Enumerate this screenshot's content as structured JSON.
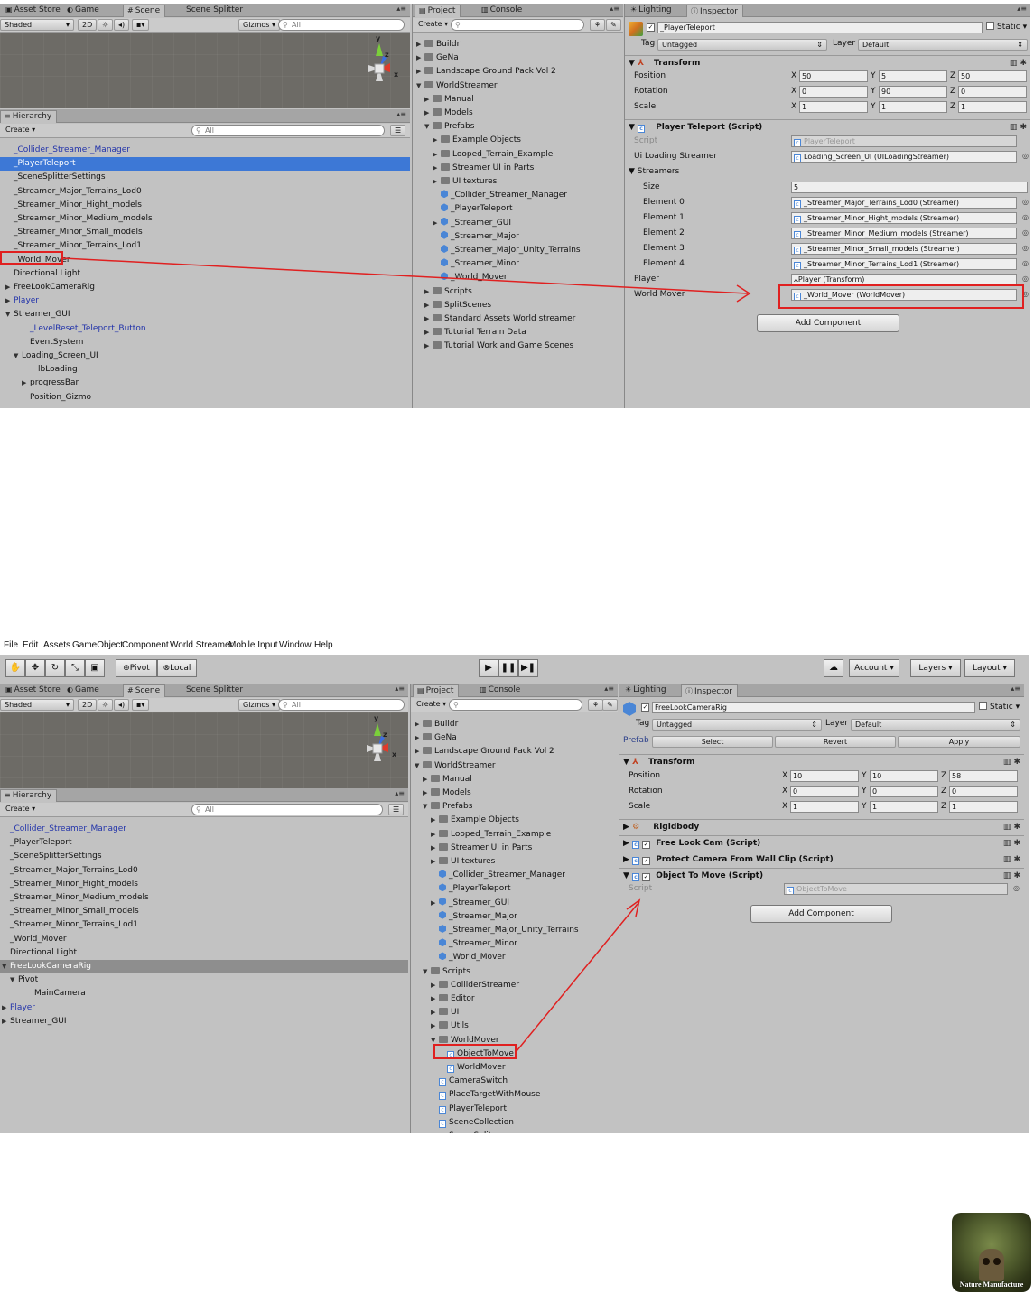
{
  "shot1": {
    "scene_tabs": [
      "Asset Store",
      "Game",
      "Scene",
      "Scene Splitter"
    ],
    "scene_toolbar": {
      "shading": "Shaded",
      "mode_2d": "2D",
      "gizmos": "Gizmos",
      "search": "All"
    },
    "gizmo_axes": {
      "y": "y",
      "z": "z",
      "x": "x"
    },
    "hierarchy": {
      "tab": "Hierarchy",
      "create": "Create",
      "search": "All",
      "items": [
        {
          "label": "_Collider_Streamer_Manager",
          "style": "blue"
        },
        {
          "label": "_PlayerTeleport",
          "style": "sel"
        },
        {
          "label": "_SceneSplitterSettings",
          "style": ""
        },
        {
          "label": "_Streamer_Major_Terrains_Lod0",
          "style": ""
        },
        {
          "label": "_Streamer_Minor_Hight_models",
          "style": ""
        },
        {
          "label": "_Streamer_Minor_Medium_models",
          "style": ""
        },
        {
          "label": "_Streamer_Minor_Small_models",
          "style": ""
        },
        {
          "label": "_Streamer_Minor_Terrains_Lod1",
          "style": ""
        },
        {
          "label": "_World_Mover",
          "style": ""
        },
        {
          "label": "Directional Light",
          "style": ""
        },
        {
          "label": "FreeLookCameraRig",
          "style": "",
          "tri": "▶"
        },
        {
          "label": "Player",
          "style": "blue",
          "tri": "▶"
        },
        {
          "label": "Streamer_GUI",
          "style": "",
          "tri": "▼"
        },
        {
          "label": "_LevelReset_Teleport_Button",
          "style": "blue",
          "indent": 2
        },
        {
          "label": "EventSystem",
          "style": "",
          "indent": 2
        },
        {
          "label": "Loading_Screen_UI",
          "style": "",
          "tri": "▼",
          "indent": 1
        },
        {
          "label": "lbLoading",
          "style": "",
          "indent": 3
        },
        {
          "label": "progressBar",
          "style": "",
          "tri": "▶",
          "indent": 2
        },
        {
          "label": "Position_Gizmo",
          "style": "",
          "indent": 2
        }
      ]
    },
    "project": {
      "tabs": [
        "Project",
        "Console"
      ],
      "create": "Create",
      "items": [
        {
          "label": "Buildr",
          "kind": "folder",
          "indent": 0,
          "tri": "▶"
        },
        {
          "label": "GeNa",
          "kind": "folder",
          "indent": 0,
          "tri": "▶"
        },
        {
          "label": "Landscape Ground Pack  Vol 2",
          "kind": "folder",
          "indent": 0,
          "tri": "▶"
        },
        {
          "label": "WorldStreamer",
          "kind": "folder",
          "indent": 0,
          "tri": "▼"
        },
        {
          "label": "Manual",
          "kind": "folder",
          "indent": 1,
          "tri": "▶"
        },
        {
          "label": "Models",
          "kind": "folder",
          "indent": 1,
          "tri": "▶"
        },
        {
          "label": "Prefabs",
          "kind": "folder",
          "indent": 1,
          "tri": "▼"
        },
        {
          "label": "Example Objects",
          "kind": "folder",
          "indent": 2,
          "tri": "▶"
        },
        {
          "label": "Looped_Terrain_Example",
          "kind": "folder",
          "indent": 2,
          "tri": "▶"
        },
        {
          "label": "Streamer UI in Parts",
          "kind": "folder",
          "indent": 2,
          "tri": "▶"
        },
        {
          "label": "UI textures",
          "kind": "folder",
          "indent": 2,
          "tri": "▶"
        },
        {
          "label": "_Collider_Streamer_Manager",
          "kind": "prefab",
          "indent": 2
        },
        {
          "label": "_PlayerTeleport",
          "kind": "prefab",
          "indent": 2
        },
        {
          "label": "_Streamer_GUI",
          "kind": "prefab",
          "indent": 2,
          "tri": "▶"
        },
        {
          "label": "_Streamer_Major",
          "kind": "prefab",
          "indent": 2
        },
        {
          "label": "_Streamer_Major_Unity_Terrains",
          "kind": "prefab",
          "indent": 2
        },
        {
          "label": "_Streamer_Minor",
          "kind": "prefab",
          "indent": 2
        },
        {
          "label": "_World_Mover",
          "kind": "prefab",
          "indent": 2
        },
        {
          "label": "Scripts",
          "kind": "folder",
          "indent": 1,
          "tri": "▶"
        },
        {
          "label": "SplitScenes",
          "kind": "folder",
          "indent": 1,
          "tri": "▶"
        },
        {
          "label": "Standard Assets World streamer",
          "kind": "folder",
          "indent": 1,
          "tri": "▶"
        },
        {
          "label": "Tutorial Terrain Data",
          "kind": "folder",
          "indent": 1,
          "tri": "▶"
        },
        {
          "label": "Tutorial Work and Game Scenes",
          "kind": "folder",
          "indent": 1,
          "tri": "▶"
        }
      ]
    },
    "inspector": {
      "tabs": [
        "Lighting",
        "Inspector"
      ],
      "object_name": "_PlayerTeleport",
      "static_label": "Static",
      "tag_label": "Tag",
      "tag_value": "Untagged",
      "layer_label": "Layer",
      "layer_value": "Default",
      "transform_title": "Transform",
      "position_label": "Position",
      "position": [
        "50",
        "5",
        "50"
      ],
      "rotation_label": "Rotation",
      "rotation": [
        "0",
        "90",
        "0"
      ],
      "scale_label": "Scale",
      "scale": [
        "1",
        "1",
        "1"
      ],
      "axis": [
        "X",
        "Y",
        "Z"
      ],
      "script_title": "Player Teleport (Script)",
      "script_label": "Script",
      "script_value": "PlayerTeleport",
      "ui_label": "Ui Loading Streamer",
      "ui_value": "Loading_Screen_UI (UILoadingStreamer)",
      "streamers_label": "Streamers",
      "size_label": "Size",
      "size_value": "5",
      "elements": [
        {
          "label": "Element 0",
          "value": "_Streamer_Major_Terrains_Lod0 (Streamer)"
        },
        {
          "label": "Element 1",
          "value": "_Streamer_Minor_Hight_models (Streamer)"
        },
        {
          "label": "Element 2",
          "value": "_Streamer_Minor_Medium_models (Streamer)"
        },
        {
          "label": "Element 3",
          "value": "_Streamer_Minor_Small_models (Streamer)"
        },
        {
          "label": "Element 4",
          "value": "_Streamer_Minor_Terrains_Lod1 (Streamer)"
        }
      ],
      "player_label": "Player",
      "player_value": "Player (Transform)",
      "world_mover_label": "World Mover",
      "world_mover_value": "_World_Mover (WorldMover)",
      "add_component": "Add Component"
    }
  },
  "shot2": {
    "menu": [
      "File",
      "Edit",
      "Assets",
      "GameObject",
      "Component",
      "World Streamer",
      "Mobile Input",
      "Window",
      "Help"
    ],
    "toolbar": {
      "pivot": "Pivot",
      "local": "Local",
      "account": "Account",
      "layers": "Layers",
      "layout": "Layout"
    },
    "scene_tabs": [
      "Asset Store",
      "Game",
      "Scene",
      "Scene Splitter"
    ],
    "scene_toolbar": {
      "shading": "Shaded",
      "mode_2d": "2D",
      "gizmos": "Gizmos",
      "search": "All"
    },
    "gizmo_axes": {
      "y": "y",
      "z": "z",
      "x": "x"
    },
    "hierarchy": {
      "tab": "Hierarchy",
      "create": "Create",
      "search": "All",
      "items": [
        {
          "label": "_Collider_Streamer_Manager",
          "style": "blue"
        },
        {
          "label": "_PlayerTeleport",
          "style": ""
        },
        {
          "label": "_SceneSplitterSettings",
          "style": ""
        },
        {
          "label": "_Streamer_Major_Terrains_Lod0",
          "style": ""
        },
        {
          "label": "_Streamer_Minor_Hight_models",
          "style": ""
        },
        {
          "label": "_Streamer_Minor_Medium_models",
          "style": ""
        },
        {
          "label": "_Streamer_Minor_Small_models",
          "style": ""
        },
        {
          "label": "_Streamer_Minor_Terrains_Lod1",
          "style": ""
        },
        {
          "label": "_World_Mover",
          "style": ""
        },
        {
          "label": "Directional Light",
          "style": ""
        },
        {
          "label": "FreeLookCameraRig",
          "style": "hl",
          "tri": "▼"
        },
        {
          "label": "Pivot",
          "style": "",
          "tri": "▼",
          "indent": 1
        },
        {
          "label": "MainCamera",
          "style": "",
          "indent": 3
        },
        {
          "label": "Player",
          "style": "blue",
          "tri": "▶"
        },
        {
          "label": "Streamer_GUI",
          "style": "",
          "tri": "▶"
        }
      ]
    },
    "project": {
      "tabs": [
        "Project",
        "Console"
      ],
      "create": "Create",
      "items": [
        {
          "label": "Buildr",
          "kind": "folder",
          "indent": 0,
          "tri": "▶"
        },
        {
          "label": "GeNa",
          "kind": "folder",
          "indent": 0,
          "tri": "▶"
        },
        {
          "label": "Landscape Ground Pack  Vol 2",
          "kind": "folder",
          "indent": 0,
          "tri": "▶"
        },
        {
          "label": "WorldStreamer",
          "kind": "folder",
          "indent": 0,
          "tri": "▼"
        },
        {
          "label": "Manual",
          "kind": "folder",
          "indent": 1,
          "tri": "▶"
        },
        {
          "label": "Models",
          "kind": "folder",
          "indent": 1,
          "tri": "▶"
        },
        {
          "label": "Prefabs",
          "kind": "folder",
          "indent": 1,
          "tri": "▼"
        },
        {
          "label": "Example Objects",
          "kind": "folder",
          "indent": 2,
          "tri": "▶"
        },
        {
          "label": "Looped_Terrain_Example",
          "kind": "folder",
          "indent": 2,
          "tri": "▶"
        },
        {
          "label": "Streamer UI in Parts",
          "kind": "folder",
          "indent": 2,
          "tri": "▶"
        },
        {
          "label": "UI textures",
          "kind": "folder",
          "indent": 2,
          "tri": "▶"
        },
        {
          "label": "_Collider_Streamer_Manager",
          "kind": "prefab",
          "indent": 2
        },
        {
          "label": "_PlayerTeleport",
          "kind": "prefab",
          "indent": 2
        },
        {
          "label": "_Streamer_GUI",
          "kind": "prefab",
          "indent": 2,
          "tri": "▶"
        },
        {
          "label": "_Streamer_Major",
          "kind": "prefab",
          "indent": 2
        },
        {
          "label": "_Streamer_Major_Unity_Terrains",
          "kind": "prefab",
          "indent": 2
        },
        {
          "label": "_Streamer_Minor",
          "kind": "prefab",
          "indent": 2
        },
        {
          "label": "_World_Mover",
          "kind": "prefab",
          "indent": 2
        },
        {
          "label": "Scripts",
          "kind": "folder",
          "indent": 1,
          "tri": "▼"
        },
        {
          "label": "ColliderStreamer",
          "kind": "folder",
          "indent": 2,
          "tri": "▶"
        },
        {
          "label": "Editor",
          "kind": "folder",
          "indent": 2,
          "tri": "▶"
        },
        {
          "label": "UI",
          "kind": "folder",
          "indent": 2,
          "tri": "▶"
        },
        {
          "label": "Utils",
          "kind": "folder",
          "indent": 2,
          "tri": "▶"
        },
        {
          "label": "WorldMover",
          "kind": "folder",
          "indent": 2,
          "tri": "▼"
        },
        {
          "label": "ObjectToMove",
          "kind": "script",
          "indent": 3
        },
        {
          "label": "WorldMover",
          "kind": "script",
          "indent": 3
        },
        {
          "label": "CameraSwitch",
          "kind": "script",
          "indent": 2
        },
        {
          "label": "PlaceTargetWithMouse",
          "kind": "script",
          "indent": 2
        },
        {
          "label": "PlayerTeleport",
          "kind": "script",
          "indent": 2
        },
        {
          "label": "SceneCollection",
          "kind": "script",
          "indent": 2
        },
        {
          "label": "SceneSplit",
          "kind": "script",
          "indent": 2
        }
      ]
    },
    "inspector": {
      "tabs": [
        "Lighting",
        "Inspector"
      ],
      "object_name": "FreeLookCameraRig",
      "static_label": "Static",
      "tag_label": "Tag",
      "tag_value": "Untagged",
      "layer_label": "Layer",
      "layer_value": "Default",
      "prefab_label": "Prefab",
      "prefab_select": "Select",
      "prefab_revert": "Revert",
      "prefab_apply": "Apply",
      "transform_title": "Transform",
      "position_label": "Position",
      "position": [
        "10",
        "10",
        "58"
      ],
      "rotation_label": "Rotation",
      "rotation": [
        "0",
        "0",
        "0"
      ],
      "scale_label": "Scale",
      "scale": [
        "1",
        "1",
        "1"
      ],
      "axis": [
        "X",
        "Y",
        "Z"
      ],
      "components": [
        "Rigidbody",
        "Free Look Cam (Script)",
        "Protect Camera From Wall Clip (Script)",
        "Object To Move (Script)"
      ],
      "script_label": "Script",
      "script_value": "ObjectToMove",
      "add_component": "Add Component"
    }
  },
  "logo_text": "Nature Manufacture",
  "colors": {
    "selection": "#3d78d6",
    "annotation_red": "#e02020",
    "panel_bg": "#c2c2c2"
  }
}
